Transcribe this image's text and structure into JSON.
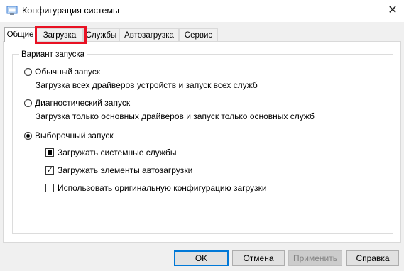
{
  "window": {
    "title": "Конфигурация системы",
    "close_glyph": "✕"
  },
  "tabs": [
    {
      "label": "Общие",
      "active": true
    },
    {
      "label": "Загрузка",
      "active": false,
      "highlighted": true
    },
    {
      "label": "Службы",
      "active": false
    },
    {
      "label": "Автозагрузка",
      "active": false
    },
    {
      "label": "Сервис",
      "active": false
    }
  ],
  "startup_group": {
    "title": "Вариант запуска",
    "options": [
      {
        "label": "Обычный запуск",
        "description": "Загрузка всех драйверов устройств и запуск всех служб",
        "selected": false
      },
      {
        "label": "Диагностический запуск",
        "description": "Загрузка только основных драйверов и запуск только основных служб",
        "selected": false
      },
      {
        "label": "Выборочный запуск",
        "selected": true
      }
    ],
    "checkboxes": [
      {
        "label": "Загружать системные службы",
        "state": "indeterminate"
      },
      {
        "label": "Загружать элементы автозагрузки",
        "state": "checked"
      },
      {
        "label": "Использовать оригинальную конфигурацию загрузки",
        "state": "unchecked"
      }
    ]
  },
  "buttons": {
    "ok": "OK",
    "cancel": "Отмена",
    "apply": "Применить",
    "help": "Справка"
  },
  "colors": {
    "highlight": "#e81123",
    "focus": "#0078d7"
  }
}
